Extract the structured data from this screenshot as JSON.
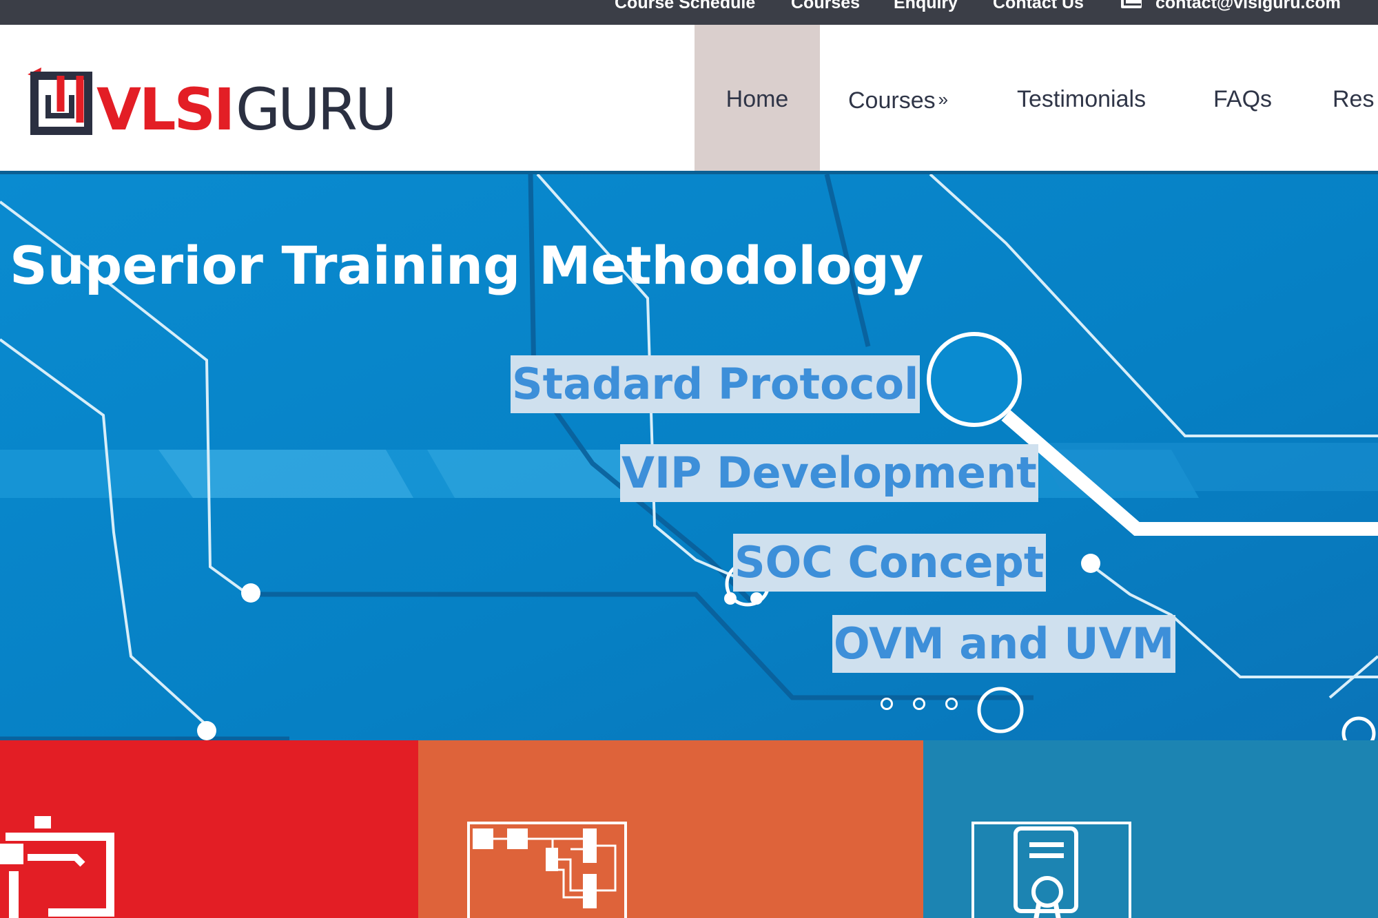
{
  "topbar": {
    "links": [
      "Course Schedule",
      "Courses",
      "Enquiry",
      "Contact Us"
    ],
    "email": "contact@vlsiguru.com",
    "icon": "mail-icon"
  },
  "logo": {
    "text_vlsi": "VLSI",
    "text_guru": "GURU"
  },
  "nav": {
    "items": [
      {
        "label": "Home",
        "active": true
      },
      {
        "label": "Courses",
        "has_submenu": true,
        "submenu_marker": "»"
      },
      {
        "label": "Testimonials"
      },
      {
        "label": "FAQs"
      },
      {
        "label": "Res"
      }
    ]
  },
  "hero": {
    "title": "Superior Training Methodology",
    "highlights": [
      "Stadard Protocol",
      "VIP Development",
      "SOC Concept",
      "OVM and UVM"
    ],
    "slides": 3
  },
  "tiles": [
    {
      "color": "#e31e25",
      "icon": "presentation-board-icon"
    },
    {
      "color": "#de633a",
      "icon": "block-diagram-icon"
    },
    {
      "color": "#1c84b2",
      "icon": "certificate-icon"
    }
  ],
  "colors": {
    "topbar": "#3b3e47",
    "nav_active": "#dacfcd",
    "hero_blue": "#0a84c4",
    "highlight_bg": "#cfe0ee",
    "highlight_text": "#3d8fd9",
    "logo_red": "#e31e25",
    "logo_navy": "#2b3041"
  }
}
